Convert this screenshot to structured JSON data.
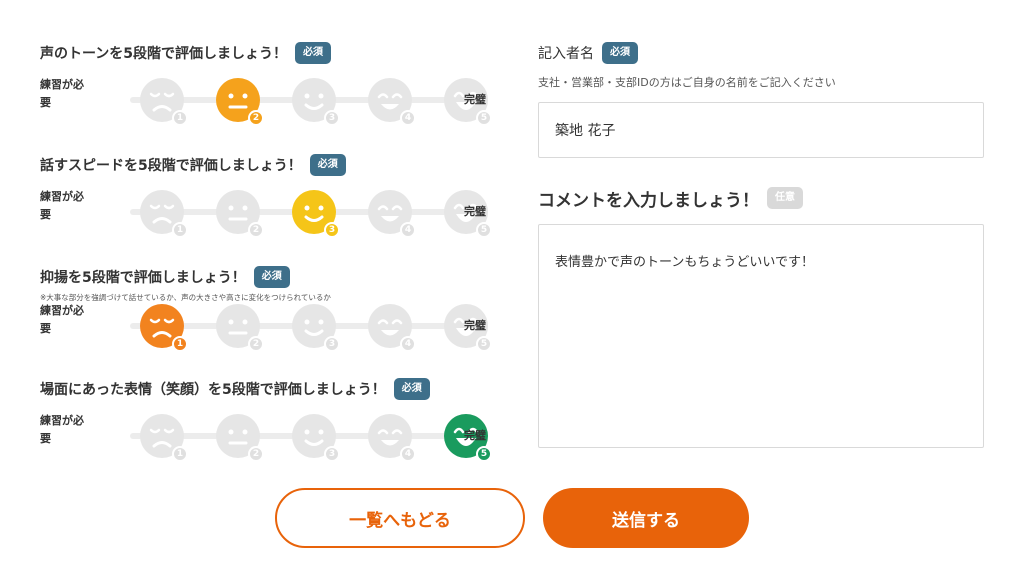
{
  "questions": [
    {
      "title": "声のトーンを5段階で評価しましょう！",
      "badge": "必須",
      "note": "",
      "low_label": "練習が必要",
      "high_label": "完璧",
      "selected": 2,
      "selected_color": "#f5a21c",
      "levels": [
        "1",
        "2",
        "3",
        "4",
        "5"
      ]
    },
    {
      "title": "話すスピードを5段階で評価しましょう！",
      "badge": "必須",
      "note": "",
      "low_label": "練習が必要",
      "high_label": "完璧",
      "selected": 3,
      "selected_color": "#f5c518",
      "levels": [
        "1",
        "2",
        "3",
        "4",
        "5"
      ]
    },
    {
      "title": "抑揚を5段階で評価しましょう！",
      "badge": "必須",
      "note": "※大事な部分を強調づけて話せているか、声の大きさや高さに変化をつけられているか",
      "low_label": "練習が必要",
      "high_label": "完璧",
      "selected": 1,
      "selected_color": "#f2831f",
      "levels": [
        "1",
        "2",
        "3",
        "4",
        "5"
      ]
    },
    {
      "title": "場面にあった表情（笑顔）を5段階で評価しましょう！",
      "badge": "必須",
      "note": "",
      "low_label": "練習が必要",
      "high_label": "完璧",
      "selected": 5,
      "selected_color": "#1a9b5e",
      "levels": [
        "1",
        "2",
        "3",
        "4",
        "5"
      ]
    }
  ],
  "entrant": {
    "label": "記入者名",
    "badge": "必須",
    "hint": "支社・営業部・支部IDの方はご自身の名前をご記入ください",
    "value": "築地 花子"
  },
  "comment": {
    "label": "コメントを入力しましょう！",
    "badge": "任意",
    "value": "表情豊かで声のトーンもちょうどいいです！"
  },
  "buttons": {
    "back": "一覧へもどる",
    "submit": "送信する"
  },
  "colors": {
    "accent": "#e8630a",
    "badge_required": "#3e6f8a",
    "badge_optional": "#d9d9d9",
    "face_inactive": "#e6e6e6"
  }
}
